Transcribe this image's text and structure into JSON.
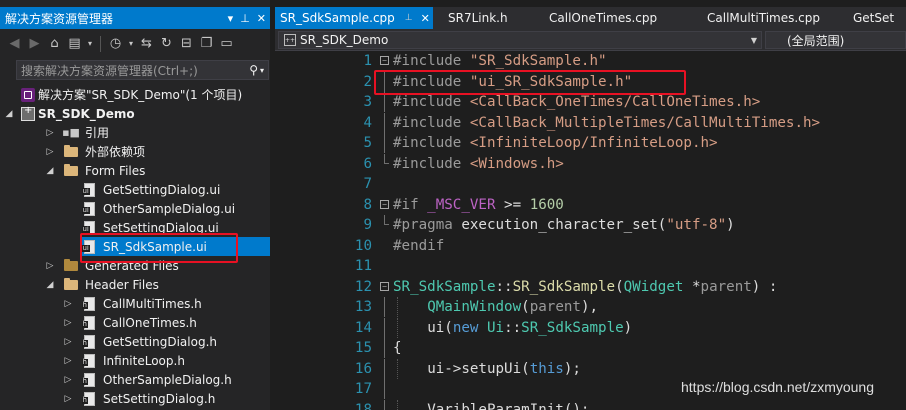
{
  "solution_explorer": {
    "title": "解决方案资源管理器",
    "search_placeholder": "搜索解决方案资源管理器(Ctrl+;)",
    "tree": [
      {
        "label": "解决方案\"SR_SDK_Demo\"(1 个项目)",
        "icon": "solution-icon",
        "depth": 0,
        "arrow": "",
        "bold": false
      },
      {
        "label": "SR_SDK_Demo",
        "icon": "project-icon",
        "depth": 0,
        "arrow": "expanded",
        "bold": true
      },
      {
        "label": "引用",
        "icon": "references-icon",
        "depth": 1,
        "arrow": "collapsed",
        "bold": false
      },
      {
        "label": "外部依赖项",
        "icon": "external-deps-icon",
        "depth": 1,
        "arrow": "collapsed",
        "bold": false
      },
      {
        "label": "Form Files",
        "icon": "folder-icon",
        "depth": 1,
        "arrow": "expanded",
        "bold": false
      },
      {
        "label": "GetSettingDialog.ui",
        "icon": "ui-file-icon",
        "depth": 2,
        "arrow": "",
        "bold": false
      },
      {
        "label": "OtherSampleDialog.ui",
        "icon": "ui-file-icon",
        "depth": 2,
        "arrow": "",
        "bold": false
      },
      {
        "label": "SetSettingDialog.ui",
        "icon": "ui-file-icon",
        "depth": 2,
        "arrow": "",
        "bold": false
      },
      {
        "label": "SR_SdkSample.ui",
        "icon": "ui-file-icon",
        "depth": 2,
        "arrow": "",
        "bold": false,
        "selected": true
      },
      {
        "label": "Generated Files",
        "icon": "folder-dark-icon",
        "depth": 1,
        "arrow": "collapsed",
        "bold": false
      },
      {
        "label": "Header Files",
        "icon": "folder-icon",
        "depth": 1,
        "arrow": "expanded",
        "bold": false
      },
      {
        "label": "CallMultiTimes.h",
        "icon": "header-file-icon",
        "depth": 2,
        "arrow": "collapsed",
        "bold": false
      },
      {
        "label": "CallOneTimes.h",
        "icon": "header-file-icon",
        "depth": 2,
        "arrow": "collapsed",
        "bold": false
      },
      {
        "label": "GetSettingDialog.h",
        "icon": "header-file-icon",
        "depth": 2,
        "arrow": "collapsed",
        "bold": false
      },
      {
        "label": "InfiniteLoop.h",
        "icon": "header-file-icon",
        "depth": 2,
        "arrow": "collapsed",
        "bold": false
      },
      {
        "label": "OtherSampleDialog.h",
        "icon": "header-file-icon",
        "depth": 2,
        "arrow": "collapsed",
        "bold": false
      },
      {
        "label": "SetSettingDialog.h",
        "icon": "header-file-icon",
        "depth": 2,
        "arrow": "collapsed",
        "bold": false
      }
    ]
  },
  "editor": {
    "tabs": [
      {
        "label": "SR_SdkSample.cpp",
        "active": true
      },
      {
        "label": "SR7Link.h",
        "active": false
      },
      {
        "label": "CallOneTimes.cpp",
        "active": false
      },
      {
        "label": "CallMultiTimes.cpp",
        "active": false
      },
      {
        "label": "GetSet",
        "active": false
      }
    ],
    "nav_project": "SR_SDK_Demo",
    "nav_scope": "(全局范围)",
    "lines": [
      {
        "n": "1",
        "fold": "minus",
        "tokens": [
          [
            "pp",
            "#include "
          ],
          [
            "str",
            "\"SR_SdkSample.h\""
          ]
        ]
      },
      {
        "n": "2",
        "fold": "guide",
        "tokens": [
          [
            "pp",
            "#include "
          ],
          [
            "str",
            "\"ui_SR_SdkSample.h\""
          ]
        ]
      },
      {
        "n": "3",
        "fold": "guide",
        "tokens": [
          [
            "pp",
            "#include "
          ],
          [
            "str",
            "<CallBack_OneTimes/CallOneTimes.h>"
          ]
        ]
      },
      {
        "n": "4",
        "fold": "guide",
        "tokens": [
          [
            "pp",
            "#include "
          ],
          [
            "str",
            "<CallBack_MultipleTimes/CallMultiTimes.h>"
          ]
        ]
      },
      {
        "n": "5",
        "fold": "guide",
        "tokens": [
          [
            "pp",
            "#include "
          ],
          [
            "str",
            "<InfiniteLoop/InfiniteLoop.h>"
          ]
        ]
      },
      {
        "n": "6",
        "fold": "end",
        "tokens": [
          [
            "pp",
            "#include "
          ],
          [
            "str",
            "<Windows.h>"
          ]
        ]
      },
      {
        "n": "7",
        "fold": "",
        "tokens": []
      },
      {
        "n": "8",
        "fold": "minus",
        "tokens": [
          [
            "pp",
            "#if "
          ],
          [
            "mac",
            "_MSC_VER"
          ],
          [
            "pl",
            " >= "
          ],
          [
            "num",
            "1600"
          ]
        ]
      },
      {
        "n": "9",
        "fold": "end",
        "tokens": [
          [
            "pp",
            "#pragma "
          ],
          [
            "pl",
            "execution_character_set("
          ],
          [
            "str",
            "\"utf-8\""
          ],
          [
            "pl",
            ")"
          ]
        ]
      },
      {
        "n": "10",
        "fold": "",
        "tokens": [
          [
            "pp",
            "#endif"
          ]
        ]
      },
      {
        "n": "11",
        "fold": "",
        "tokens": []
      },
      {
        "n": "12",
        "fold": "minus",
        "tokens": [
          [
            "cls",
            "SR_SdkSample"
          ],
          [
            "pl",
            "::"
          ],
          [
            "fn",
            "SR_SdkSample"
          ],
          [
            "pl",
            "("
          ],
          [
            "cls",
            "QWidget"
          ],
          [
            "pl",
            " *"
          ],
          [
            "prm",
            "parent"
          ],
          [
            "pl",
            ") :"
          ]
        ]
      },
      {
        "n": "13",
        "fold": "guide",
        "indent": 1,
        "tokens": [
          [
            "cls",
            "QMainWindow"
          ],
          [
            "pl",
            "("
          ],
          [
            "prm",
            "parent"
          ],
          [
            "pl",
            "),"
          ]
        ]
      },
      {
        "n": "14",
        "fold": "guide",
        "indent": 1,
        "tokens": [
          [
            "pl",
            "ui("
          ],
          [
            "kw",
            "new "
          ],
          [
            "cls",
            "Ui"
          ],
          [
            "pl",
            "::"
          ],
          [
            "cls",
            "SR_SdkSample"
          ],
          [
            "pl",
            ")"
          ]
        ]
      },
      {
        "n": "15",
        "fold": "guide",
        "tokens": [
          [
            "pl",
            "{"
          ]
        ]
      },
      {
        "n": "16",
        "fold": "guide",
        "indent": 1,
        "tokens": [
          [
            "pl",
            "ui->setupUi("
          ],
          [
            "kw",
            "this"
          ],
          [
            "pl",
            ");"
          ]
        ]
      },
      {
        "n": "17",
        "fold": "guide",
        "tokens": []
      },
      {
        "n": "18",
        "fold": "guide",
        "indent": 1,
        "tokens": [
          [
            "pl",
            "VaribleParamInit();"
          ]
        ]
      }
    ]
  },
  "watermark": "https://blog.csdn.net/zxmyoung",
  "colors": {
    "accent": "#007acc",
    "highlight_box": "#e81123"
  }
}
